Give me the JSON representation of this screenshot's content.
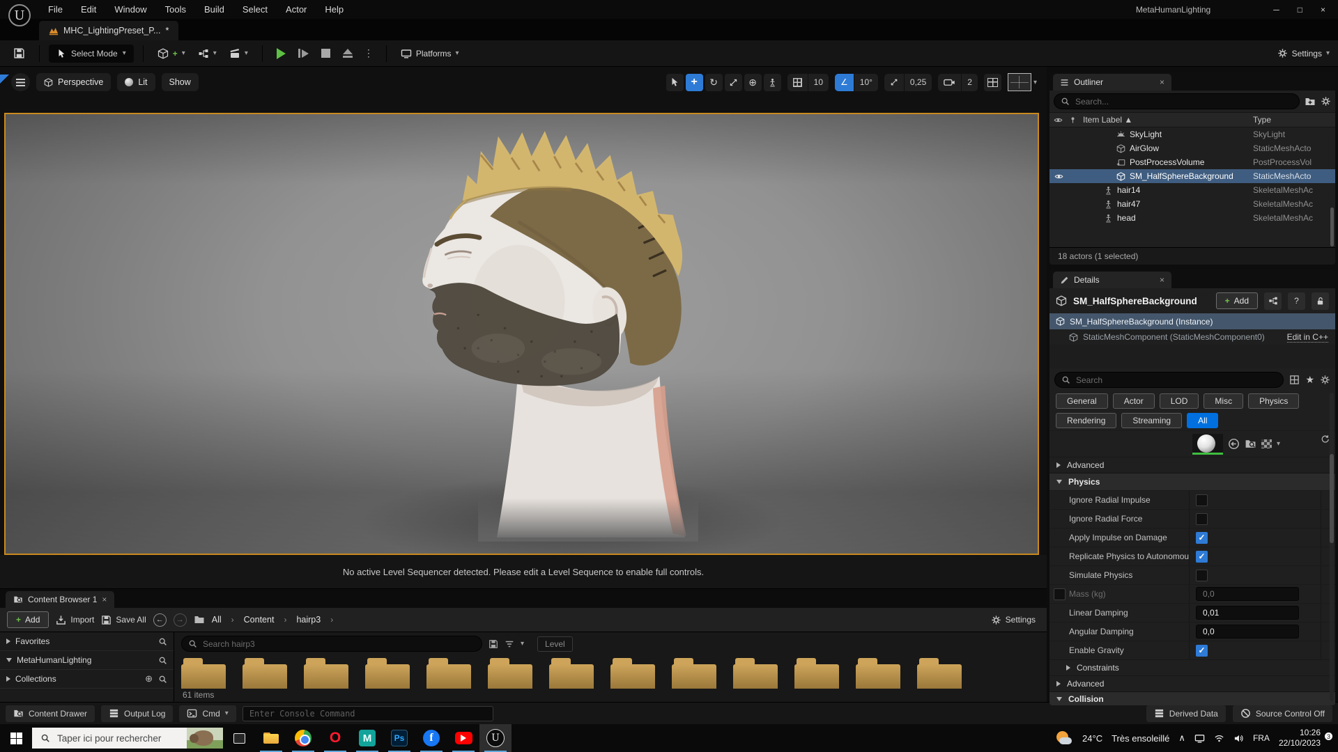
{
  "titlebar": {
    "menus": [
      "File",
      "Edit",
      "Window",
      "Tools",
      "Build",
      "Select",
      "Actor",
      "Help"
    ],
    "title": "MetaHumanLighting"
  },
  "tabbar": {
    "asset_tab": "MHC_LightingPreset_P...",
    "dirty": "*"
  },
  "toolbar": {
    "select_mode": "Select Mode",
    "platforms": "Platforms",
    "settings": "Settings"
  },
  "viewport": {
    "perspective": "Perspective",
    "lit": "Lit",
    "show": "Show",
    "snap_grid": "10",
    "snap_rotation": "10°",
    "snap_scale": "0,25",
    "camera_speed": "2",
    "message": "No active Level Sequencer detected. Please edit a Level Sequence to enable full controls."
  },
  "outliner": {
    "tab": "Outliner",
    "search_placeholder": "Search...",
    "columns": {
      "item": "Item Label ▲",
      "type": "Type"
    },
    "rows": [
      {
        "label": "SkyLight",
        "type": "SkyLight"
      },
      {
        "label": "AirGlow",
        "type": "StaticMeshActo"
      },
      {
        "label": "PostProcessVolume",
        "type": "PostProcessVol"
      },
      {
        "label": "SM_HalfSphereBackground",
        "type": "StaticMeshActo"
      },
      {
        "label": "hair14",
        "type": "SkeletalMeshAc"
      },
      {
        "label": "hair47",
        "type": "SkeletalMeshAc"
      },
      {
        "label": "head",
        "type": "SkeletalMeshAc"
      }
    ],
    "footer": "18 actors (1 selected)"
  },
  "details": {
    "tab": "Details",
    "object_name": "SM_HalfSphereBackground",
    "add_label": "Add",
    "instance": "SM_HalfSphereBackground (Instance)",
    "component": "StaticMeshComponent (StaticMeshComponent0)",
    "edit_cpp": "Edit in C++",
    "search_placeholder": "Search",
    "chips_row1": [
      "General",
      "Actor",
      "LOD",
      "Misc",
      "Physics"
    ],
    "chips_row2": [
      "Rendering",
      "Streaming",
      "All"
    ],
    "section_advanced": "Advanced",
    "section_physics": "Physics",
    "section_constraints": "Constraints",
    "section_advanced2": "Advanced",
    "section_collision": "Collision",
    "props": [
      {
        "label": "Ignore Radial Impulse",
        "checked": false
      },
      {
        "label": "Ignore Radial Force",
        "checked": false
      },
      {
        "label": "Apply Impulse on Damage",
        "checked": true
      },
      {
        "label": "Replicate Physics to Autonomou...",
        "checked": true
      },
      {
        "label": "Simulate Physics",
        "checked": false
      },
      {
        "label": "Mass (kg)",
        "value": "0,0",
        "disabled": true
      },
      {
        "label": "Linear Damping",
        "value": "0,01"
      },
      {
        "label": "Angular Damping",
        "value": "0,0"
      },
      {
        "label": "Enable Gravity",
        "checked": true
      }
    ]
  },
  "content_browser": {
    "tab": "Content Browser 1",
    "add_label": "Add",
    "import_label": "Import",
    "save_all_label": "Save All",
    "breadcrumbs": [
      "All",
      "Content",
      "hairp3"
    ],
    "settings": "Settings",
    "sidebar": [
      {
        "label": "Favorites"
      },
      {
        "label": "MetaHumanLighting"
      },
      {
        "label": "Collections"
      }
    ],
    "search_placeholder": "Search hairp3",
    "level_filter": "Level",
    "item_count": "61 items"
  },
  "statusbar": {
    "content_drawer": "Content Drawer",
    "output_log": "Output Log",
    "cmd": "Cmd",
    "console_placeholder": "Enter Console Command",
    "derived_data": "Derived Data",
    "source_control": "Source Control Off"
  },
  "taskbar": {
    "search_placeholder": "Taper ici pour rechercher",
    "temperature": "24°C",
    "weather": "Très ensoleillé",
    "language": "FRA",
    "time": "10:26",
    "date": "22/10/2023",
    "notification_count": "3",
    "app_letters": {
      "opera": "O",
      "maya": "M",
      "photoshop": "Ps",
      "facebook": "f",
      "unreal": "U"
    }
  },
  "colors": {
    "accent_blue": "#0070e0",
    "selection_blue": "#3f5d80",
    "checkbox_blue": "#2e7bd6",
    "viewport_border": "#c98a1e",
    "play_green": "#5dc044",
    "folder_gold": "#c49a4f"
  }
}
